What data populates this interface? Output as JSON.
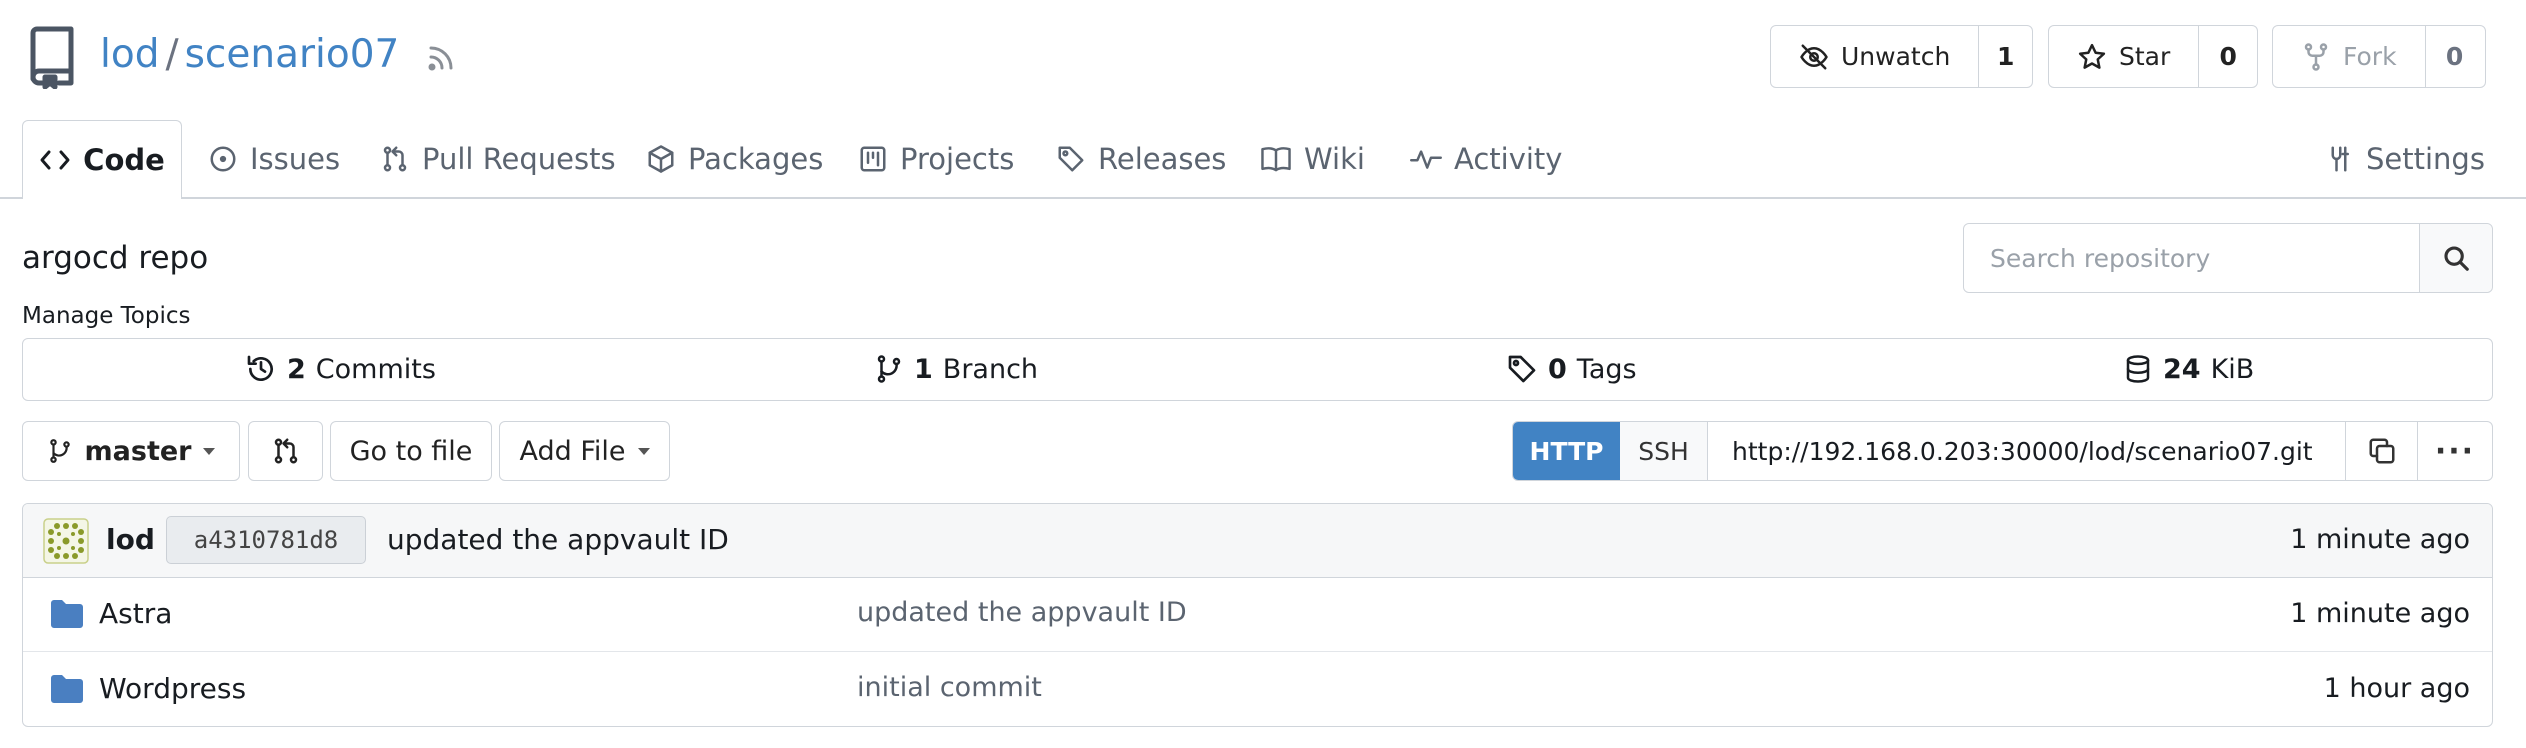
{
  "repo": {
    "owner": "lod",
    "separator": "/",
    "name": "scenario07",
    "description": "argocd repo",
    "manage_topics": "Manage Topics"
  },
  "header_actions": {
    "watch": {
      "label": "Unwatch",
      "count": "1"
    },
    "star": {
      "label": "Star",
      "count": "0"
    },
    "fork": {
      "label": "Fork",
      "count": "0"
    }
  },
  "tabs": [
    {
      "label": "Code",
      "icon": "code-icon",
      "active": true
    },
    {
      "label": "Issues",
      "icon": "issue-icon"
    },
    {
      "label": "Pull Requests",
      "icon": "pull-request-icon"
    },
    {
      "label": "Packages",
      "icon": "package-icon"
    },
    {
      "label": "Projects",
      "icon": "project-icon"
    },
    {
      "label": "Releases",
      "icon": "tag-icon"
    },
    {
      "label": "Wiki",
      "icon": "book-icon"
    },
    {
      "label": "Activity",
      "icon": "pulse-icon"
    },
    {
      "label": "Settings",
      "icon": "tools-icon"
    }
  ],
  "search": {
    "placeholder": "Search repository"
  },
  "stats": {
    "commits": {
      "count": "2",
      "label": "Commits"
    },
    "branches": {
      "count": "1",
      "label": "Branch"
    },
    "tags": {
      "count": "0",
      "label": "Tags"
    },
    "size": {
      "count": "24",
      "label": "KiB"
    }
  },
  "toolbar": {
    "branch": "master",
    "go_to_file": "Go to file",
    "add_file": "Add File",
    "clone": {
      "http_label": "HTTP",
      "ssh_label": "SSH",
      "url": "http://192.168.0.203:30000/lod/scenario07.git",
      "more": "···"
    }
  },
  "latest_commit": {
    "author": "lod",
    "sha": "a4310781d8",
    "message": "updated the appvault ID",
    "time": "1 minute ago"
  },
  "files": [
    {
      "name": "Astra",
      "type": "folder",
      "commit": "updated the appvault ID",
      "time": "1 minute ago"
    },
    {
      "name": "Wordpress",
      "type": "folder",
      "commit": "initial commit",
      "time": "1 hour ago"
    }
  ],
  "colors": {
    "accent": "#4183c4",
    "folder": "#4a7fc1",
    "border": "#d0d5db",
    "avatar": "#8a9a2a"
  }
}
